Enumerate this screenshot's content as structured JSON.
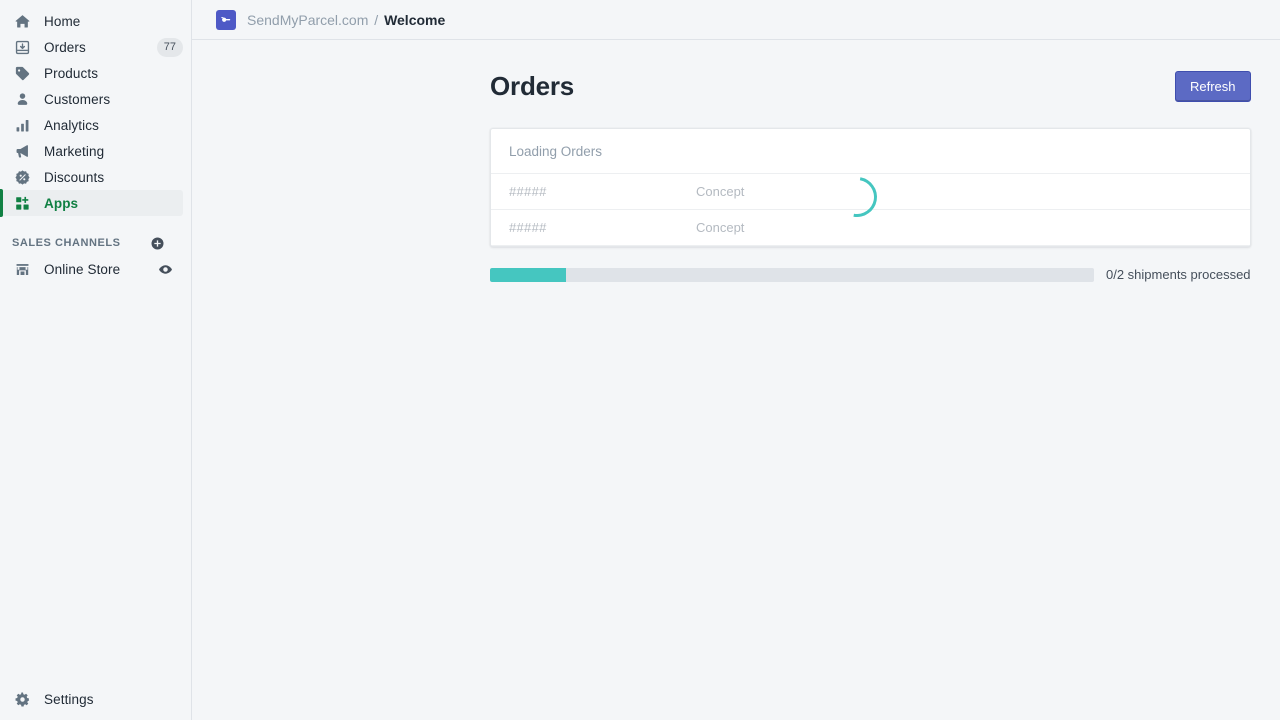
{
  "sidebar": {
    "nav": [
      {
        "id": "home",
        "label": "Home",
        "icon": "home-icon",
        "badge": null,
        "active": false
      },
      {
        "id": "orders",
        "label": "Orders",
        "icon": "orders-icon",
        "badge": "77",
        "active": false
      },
      {
        "id": "products",
        "label": "Products",
        "icon": "products-tag-icon",
        "badge": null,
        "active": false
      },
      {
        "id": "customers",
        "label": "Customers",
        "icon": "customers-person-icon",
        "badge": null,
        "active": false
      },
      {
        "id": "analytics",
        "label": "Analytics",
        "icon": "analytics-bar-chart-icon",
        "badge": null,
        "active": false
      },
      {
        "id": "marketing",
        "label": "Marketing",
        "icon": "marketing-megaphone-icon",
        "badge": null,
        "active": false
      },
      {
        "id": "discounts",
        "label": "Discounts",
        "icon": "discounts-percent-badge-icon",
        "badge": null,
        "active": false
      },
      {
        "id": "apps",
        "label": "Apps",
        "icon": "apps-grid-icon",
        "badge": null,
        "active": true
      }
    ],
    "sales_channels": {
      "title": "SALES CHANNELS",
      "add_icon": "plus-circle-icon",
      "items": [
        {
          "id": "online-store",
          "label": "Online Store",
          "icon": "storefront-icon",
          "trail_icon": "eye-icon"
        }
      ]
    },
    "settings": {
      "label": "Settings",
      "icon": "gear-icon"
    },
    "accent_color": "#108043"
  },
  "topbar": {
    "app_icon": "sendmyparcel-app-icon",
    "breadcrumb": {
      "app_name": "SendMyParcel.com",
      "separator": "/",
      "current": "Welcome"
    }
  },
  "page": {
    "title": "Orders",
    "refresh_label": "Refresh",
    "refresh_color": "#5C6AC4"
  },
  "orders_card": {
    "header": "Loading Orders",
    "columns": [
      "id",
      "status"
    ],
    "rows": [
      {
        "id": "#####",
        "status": "Concept"
      },
      {
        "id": "#####",
        "status": "Concept"
      }
    ],
    "spinner": {
      "name": "loading-spinner",
      "color": "#45C6C0"
    }
  },
  "progress": {
    "value": 0,
    "max": 2,
    "percent": "12.5%",
    "label": "0/2 shipments processed",
    "fill_color": "#45C6C0",
    "track_color": "#DFE3E8"
  }
}
